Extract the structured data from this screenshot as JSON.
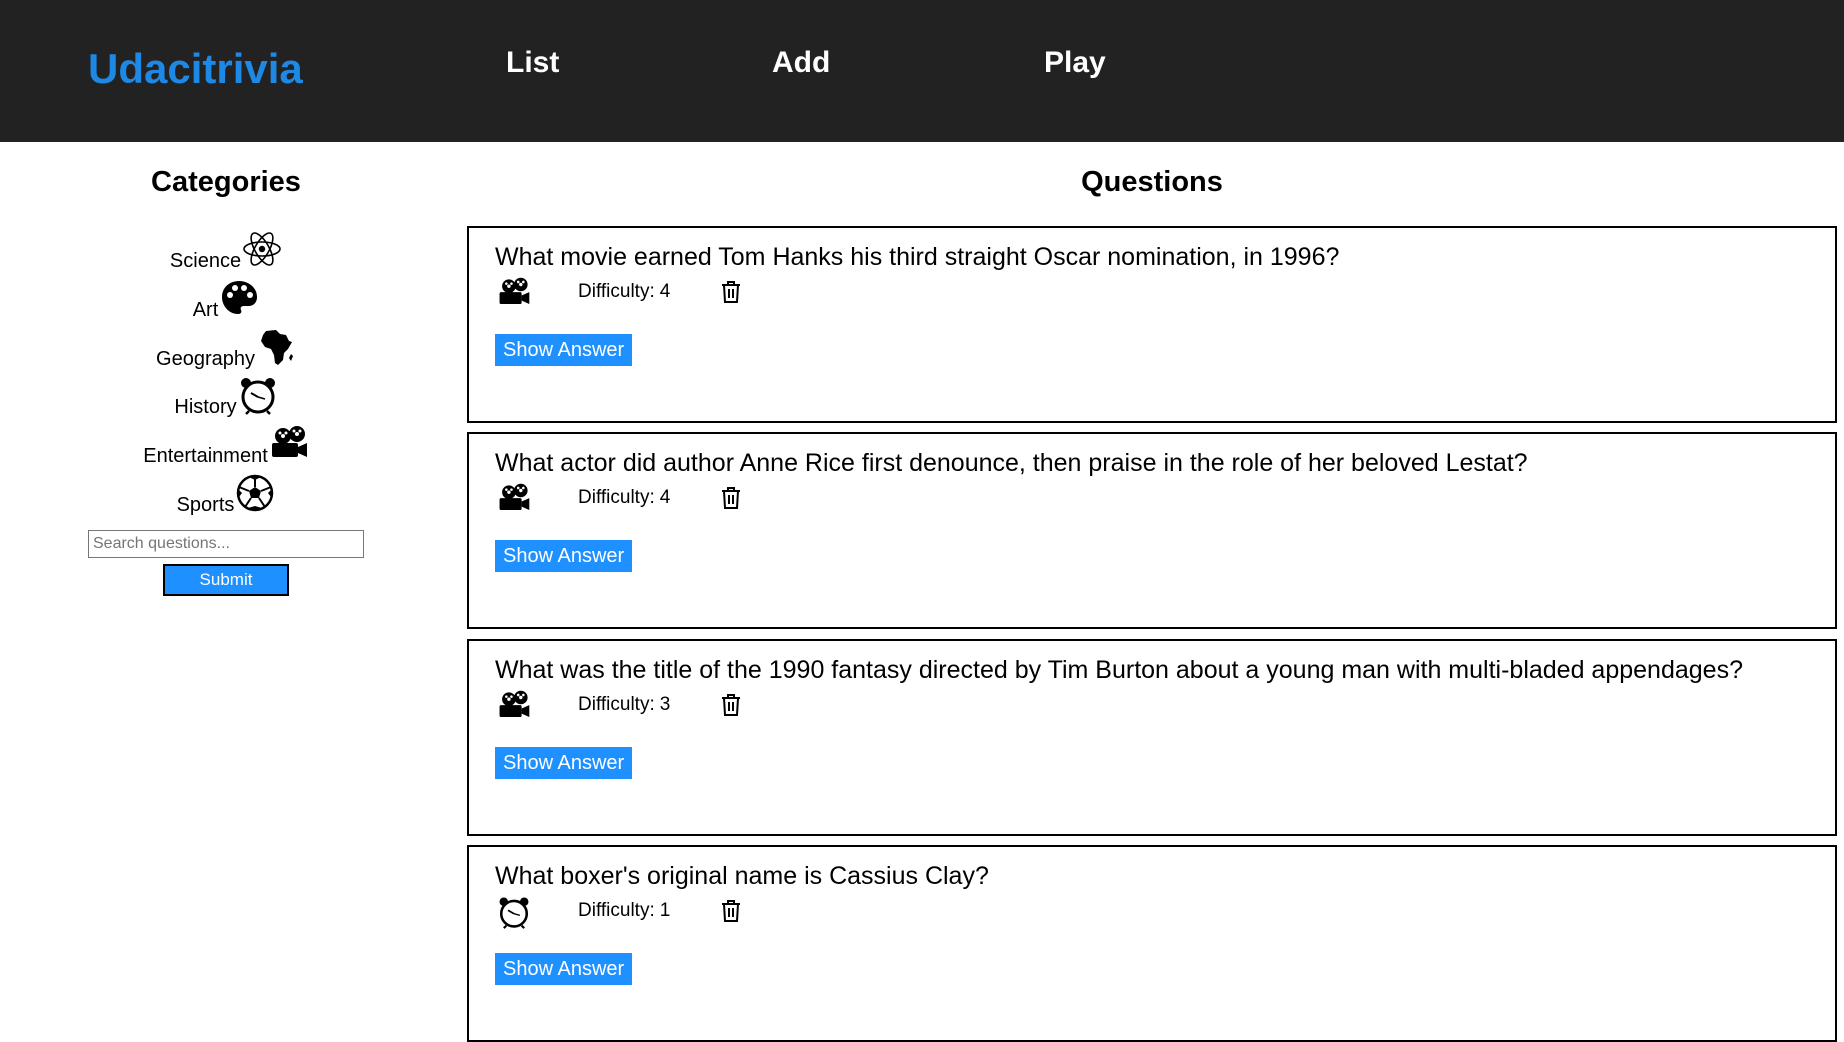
{
  "header": {
    "brand": "Udacitrivia",
    "nav": [
      {
        "label": "List"
      },
      {
        "label": "Add"
      },
      {
        "label": "Play"
      }
    ]
  },
  "colors": {
    "header_bg": "#222222",
    "brand": "#1e88e5",
    "accent": "#1e90ff"
  },
  "categories": {
    "title": "Categories",
    "items": [
      {
        "label": "Science",
        "icon": "atom-icon"
      },
      {
        "label": "Art",
        "icon": "palette-icon"
      },
      {
        "label": "Geography",
        "icon": "africa-map-icon"
      },
      {
        "label": "History",
        "icon": "alarm-clock-icon"
      },
      {
        "label": "Entertainment",
        "icon": "film-projector-icon"
      },
      {
        "label": "Sports",
        "icon": "soccer-ball-icon"
      }
    ]
  },
  "search": {
    "placeholder": "Search questions...",
    "value": "",
    "submit_label": "Submit"
  },
  "questions": {
    "title": "Questions",
    "difficulty_label": "Difficulty:",
    "show_answer_label": "Show Answer",
    "items": [
      {
        "text": "What movie earned Tom Hanks his third straight Oscar nomination, in 1996?",
        "category_icon": "film-projector-icon",
        "difficulty": "4"
      },
      {
        "text": "What actor did author Anne Rice first denounce, then praise in the role of her beloved Lestat?",
        "category_icon": "film-projector-icon",
        "difficulty": "4"
      },
      {
        "text": "What was the title of the 1990 fantasy directed by Tim Burton about a young man with multi-bladed appendages?",
        "category_icon": "film-projector-icon",
        "difficulty": "3"
      },
      {
        "text": "What boxer's original name is Cassius Clay?",
        "category_icon": "alarm-clock-icon",
        "difficulty": "1"
      }
    ]
  }
}
